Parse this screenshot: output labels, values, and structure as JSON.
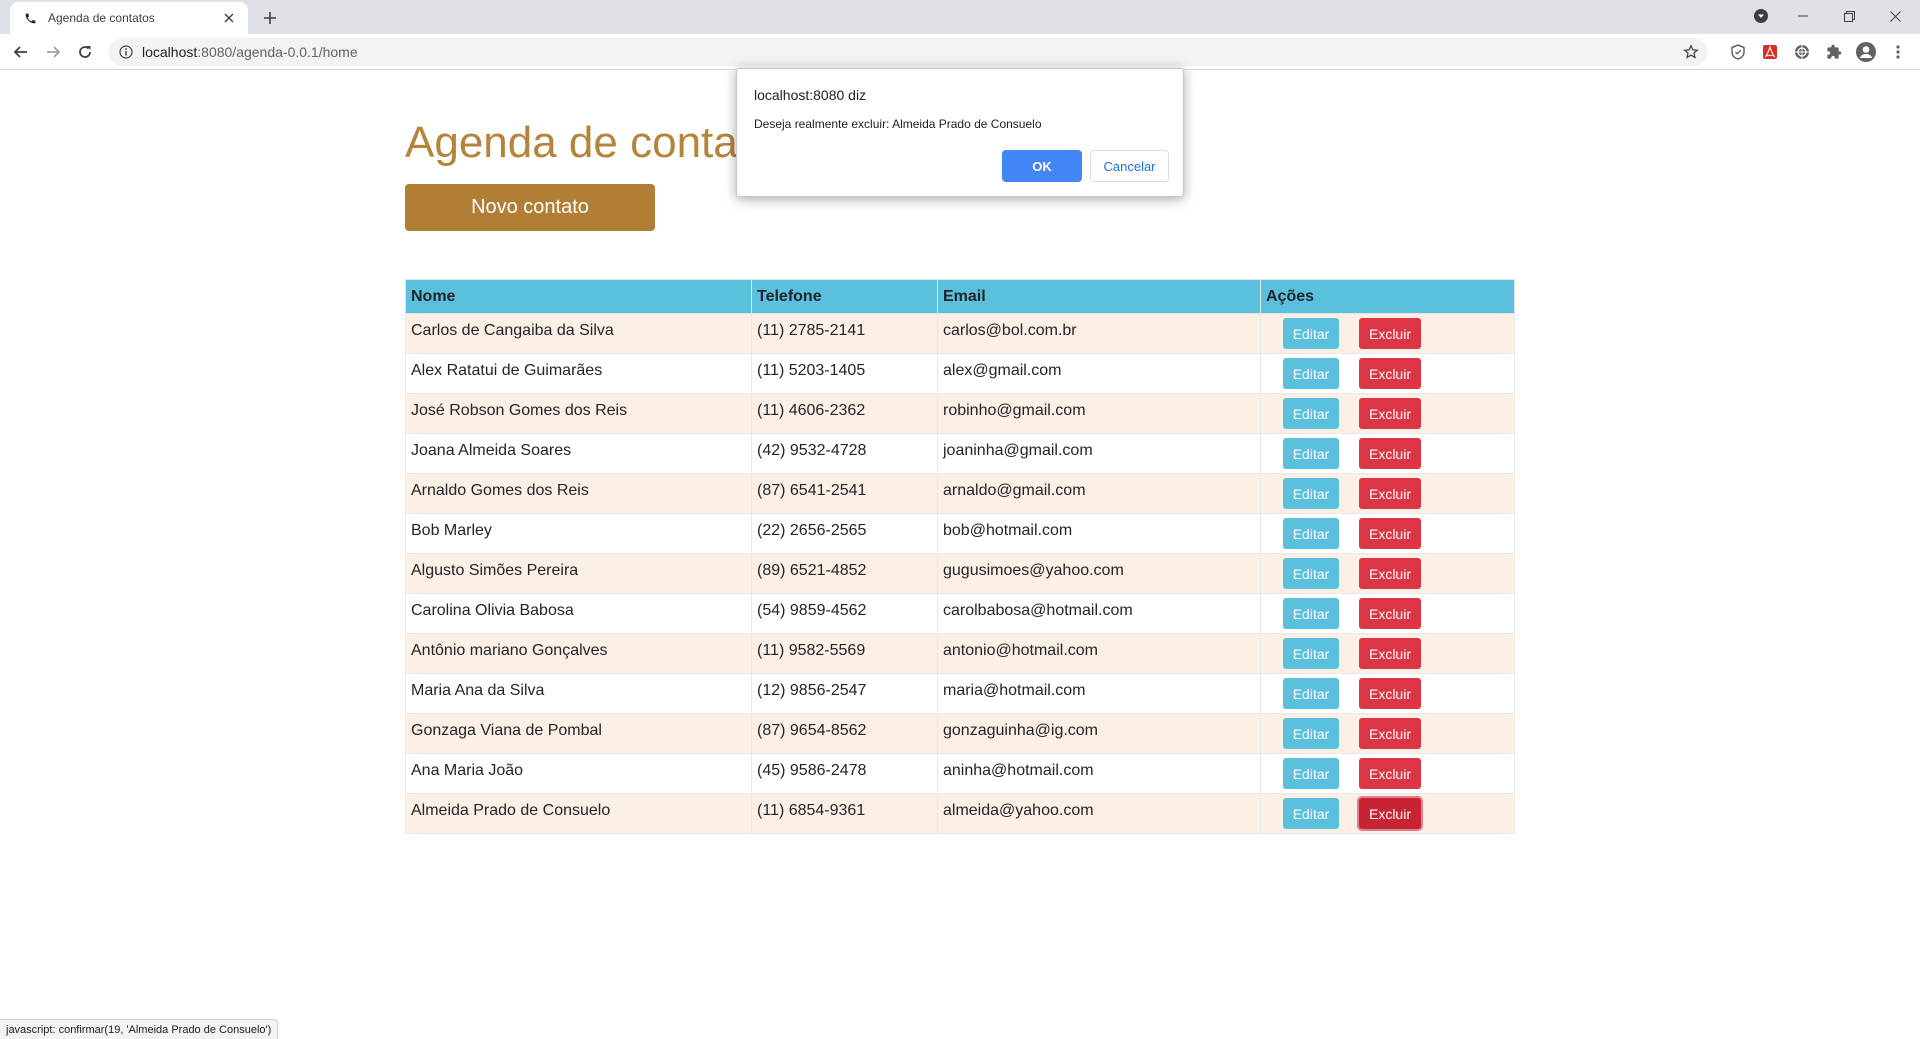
{
  "browser": {
    "tab_title": "Agenda de contatos",
    "url_host": "localhost",
    "url_path": ":8080/agenda-0.0.1/home"
  },
  "page": {
    "title": "Agenda de contatos",
    "new_contact_label": "Novo contato"
  },
  "table": {
    "headers": [
      "Nome",
      "Telefone",
      "Email",
      "Ações"
    ],
    "edit_label": "Editar",
    "delete_label": "Excluir",
    "rows": [
      {
        "nome": "Carlos de Cangaiba da Silva",
        "telefone": "(11) 2785-2141",
        "email": "carlos@bol.com.br"
      },
      {
        "nome": "Alex Ratatui de Guimarães",
        "telefone": "(11) 5203-1405",
        "email": "alex@gmail.com"
      },
      {
        "nome": "José Robson Gomes dos Reis",
        "telefone": "(11) 4606-2362",
        "email": "robinho@gmail.com"
      },
      {
        "nome": "Joana Almeida Soares",
        "telefone": "(42) 9532-4728",
        "email": "joaninha@gmail.com"
      },
      {
        "nome": "Arnaldo Gomes dos Reis",
        "telefone": "(87) 6541-2541",
        "email": "arnaldo@gmail.com"
      },
      {
        "nome": "Bob Marley",
        "telefone": "(22) 2656-2565",
        "email": "bob@hotmail.com"
      },
      {
        "nome": "Algusto Simões Pereira",
        "telefone": "(89) 6521-4852",
        "email": "gugusimoes@yahoo.com"
      },
      {
        "nome": "Carolina Olivia Babosa",
        "telefone": "(54) 9859-4562",
        "email": "carolbabosa@hotmail.com"
      },
      {
        "nome": "Antônio mariano Gonçalves",
        "telefone": "(11) 9582-5569",
        "email": "antonio@hotmail.com"
      },
      {
        "nome": "Maria Ana da Silva",
        "telefone": "(12) 9856-2547",
        "email": "maria@hotmail.com"
      },
      {
        "nome": "Gonzaga Viana de Pombal",
        "telefone": "(87) 9654-8562",
        "email": "gonzaguinha@ig.com"
      },
      {
        "nome": "Ana Maria João",
        "telefone": "(45) 9586-2478",
        "email": "aninha@hotmail.com"
      },
      {
        "nome": "Almeida Prado de Consuelo",
        "telefone": "(11) 6854-9361",
        "email": "almeida@yahoo.com"
      }
    ]
  },
  "dialog": {
    "title": "localhost:8080 diz",
    "message": "Deseja realmente excluir: Almeida Prado de Consuelo",
    "ok_label": "OK",
    "cancel_label": "Cancelar"
  },
  "statusbar": {
    "text": "javascript: confirmar(19, 'Almeida Prado de Consuelo')"
  },
  "colors": {
    "title": "#b5843a",
    "primary_button": "#b07f35",
    "header_bg": "#5bc0de",
    "row_alt_bg": "#fbf0e3",
    "edit_button": "#5bc0de",
    "delete_button": "#dc3545",
    "dialog_ok": "#4285f4"
  },
  "icons": [
    "phone-icon",
    "close-icon",
    "plus-icon",
    "back-icon",
    "forward-icon",
    "reload-icon",
    "info-icon",
    "star-icon",
    "shield-icon",
    "pdf-icon",
    "globe-icon",
    "puzzle-icon",
    "profile-icon",
    "menu-icon",
    "media-icon",
    "minimize-icon",
    "restore-icon",
    "window-close-icon"
  ]
}
